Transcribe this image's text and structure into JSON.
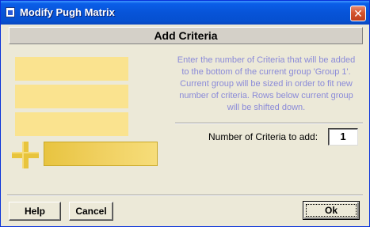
{
  "window": {
    "title": "Modify Pugh Matrix",
    "close_glyph": "✕"
  },
  "header": {
    "title": "Add Criteria"
  },
  "info": {
    "text": "Enter the number of Criteria that will be added to the bottom of the current group 'Group 1'. Current group will be sized in order to fit new number of criteria. Rows below current group will be shifted down."
  },
  "count": {
    "label": "Number of Criteria to add:",
    "value": "1"
  },
  "buttons": {
    "help": "Help",
    "cancel": "Cancel",
    "ok": "Ok"
  },
  "colors": {
    "criteria_bar": "#fae38f",
    "new_bar": "#f0d060",
    "plus": "#e8c43c",
    "info_text": "#8a8ad8"
  },
  "icons": {
    "app": "app-icon",
    "close": "close-icon",
    "plus": "plus-icon"
  }
}
